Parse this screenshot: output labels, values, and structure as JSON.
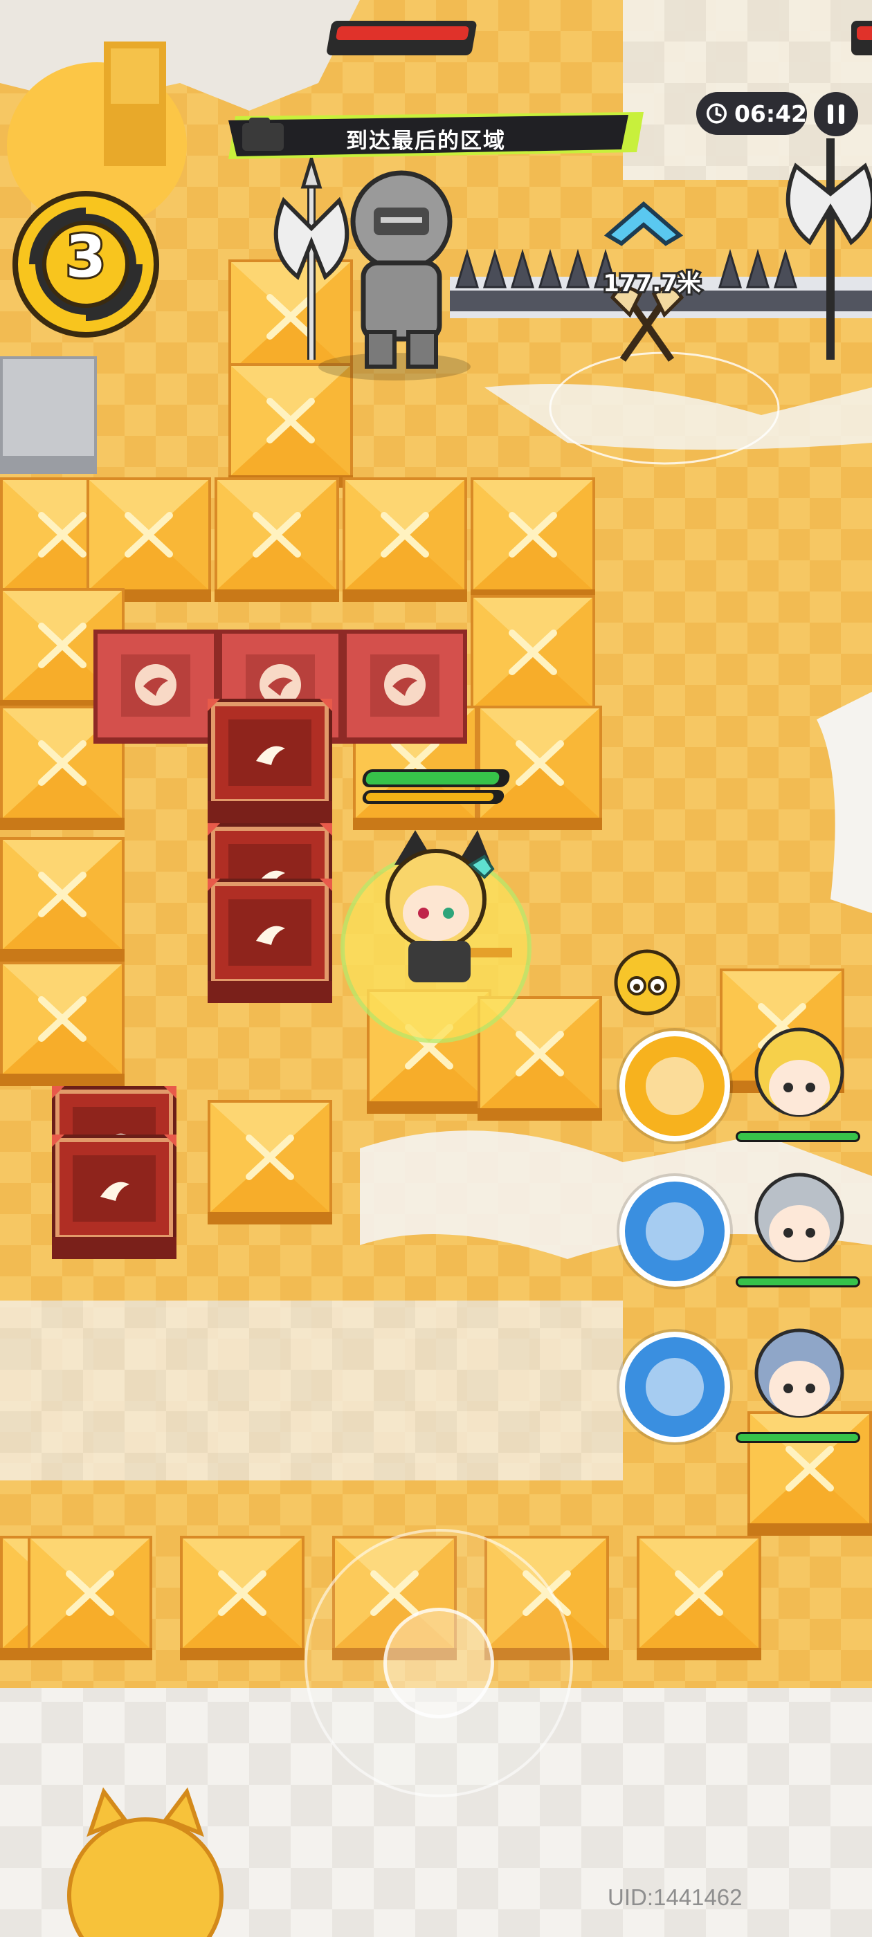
{
  "hud": {
    "objective_text": "到达最后的区域",
    "timer_text": "06:42",
    "wave_number": "3",
    "distance_text": "177.7米",
    "uid_text": "UID:1441462"
  },
  "player": {
    "health_fraction": 0.95,
    "energy_fraction": 0.95
  },
  "party": [
    {
      "name_icon": "blonde-hero-portrait",
      "skill_icon": "flame-skill-icon",
      "health_fraction": 1.0
    },
    {
      "name_icon": "silver-hair-hero-portrait",
      "skill_icon": "wind-skill-icon",
      "health_fraction": 1.0
    },
    {
      "name_icon": "blue-hair-hero-portrait",
      "skill_icon": "water-skill-icon",
      "health_fraction": 1.0
    }
  ],
  "colors": {
    "floor": "#f6c763",
    "floor_light": "#f3f0ea",
    "crate_top": "#fbbd3a",
    "crate_side": "#d98a26",
    "box_red": "#b02e24",
    "tile_red": "#d4504c",
    "hud_dark": "#2d2d33",
    "hp_green": "#37c24a",
    "energy_yellow": "#f2b316",
    "objective_accent": "#c8f03c"
  }
}
